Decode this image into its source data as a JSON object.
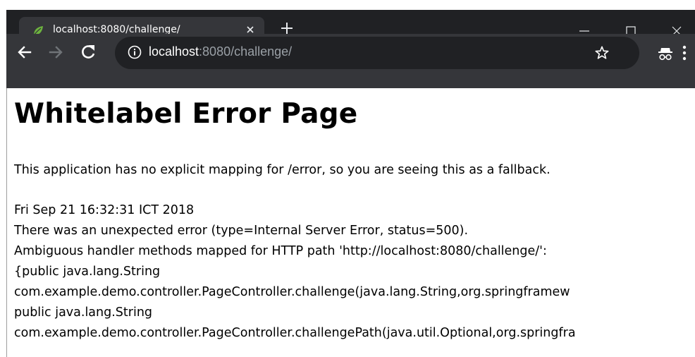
{
  "browser": {
    "tab": {
      "title": "localhost:8080/challenge/",
      "favicon": "spring-leaf-icon",
      "close_icon": "close-icon"
    },
    "new_tab_icon": "plus-icon",
    "window_controls": [
      "minimize-icon",
      "maximize-icon",
      "close-icon"
    ],
    "nav": {
      "back_icon": "arrow-left-icon",
      "forward_icon": "arrow-right-icon",
      "reload_icon": "reload-icon"
    },
    "address": {
      "info_icon": "info-icon",
      "host": "localhost",
      "rest": ":8080/challenge/"
    },
    "actions": [
      "star-icon",
      "incognito-icon",
      "more-vert-icon"
    ],
    "colors": {
      "titlebar": "#202124",
      "tab_active": "#35363a",
      "omnibox": "#202124",
      "url_host": "#ffffff",
      "url_rest": "#9aa0a6",
      "favicon": "#6db33f"
    }
  },
  "page": {
    "heading": "Whitelabel Error Page",
    "message": "This application has no explicit mapping for /error, so you are seeing this as a fallback.",
    "details": [
      "Fri Sep 21 16:32:31 ICT 2018",
      "There was an unexpected error (type=Internal Server Error, status=500).",
      "Ambiguous handler methods mapped for HTTP path 'http://localhost:8080/challenge/':",
      "{public java.lang.String",
      "com.example.demo.controller.PageController.challenge(java.lang.String,org.springframew",
      "public java.lang.String",
      "com.example.demo.controller.PageController.challengePath(java.util.Optional,org.springfra"
    ]
  }
}
